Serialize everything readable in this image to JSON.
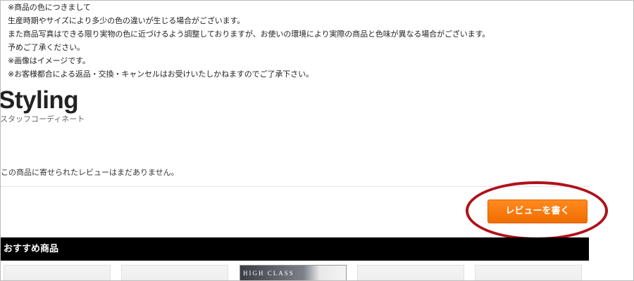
{
  "notes": [
    "※商品の色につきまして",
    "生産時期やサイズにより多少の色の違いが生じる場合がございます。",
    "また商品写真はできる限り実物の色に近づけるよう調整しておりますが、お使いの環境により実際の商品と色味が異なる場合がございます。",
    "予めご了承ください。",
    "※画像はイメージです。",
    "※お客様都合による返品・交換・キャンセルはお受けいたしかねますのでご了承下さい。"
  ],
  "styling": {
    "title": "Styling",
    "subtitle": "スタッフコーディネート"
  },
  "reviews": {
    "empty_message": "この商品に寄せられたレビューはまだありません。",
    "write_button": "レビューを書く"
  },
  "recommend": {
    "title": "おすすめ商品",
    "thumb3_text": "HIGH CLASS"
  },
  "colors": {
    "accent": "#f07a10",
    "highlight": "#b0111a",
    "bar": "#000000"
  }
}
